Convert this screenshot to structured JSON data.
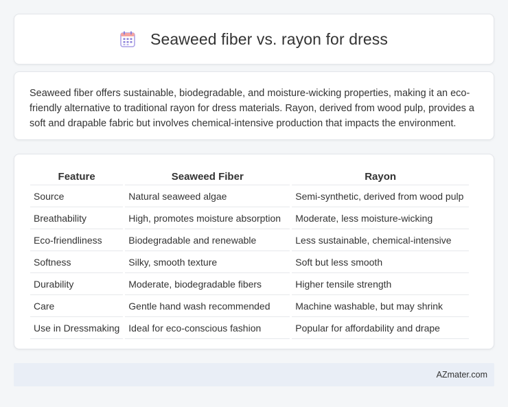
{
  "header": {
    "icon": "calendar-icon",
    "title": "Seaweed fiber vs. rayon for dress"
  },
  "summary": {
    "text": "Seaweed fiber offers sustainable, biodegradable, and moisture-wicking properties, making it an eco-friendly alternative to traditional rayon for dress materials. Rayon, derived from wood pulp, provides a soft and drapable fabric but involves chemical-intensive production that impacts the environment."
  },
  "table": {
    "headers": [
      "Feature",
      "Seaweed Fiber",
      "Rayon"
    ],
    "rows": [
      [
        "Source",
        "Natural seaweed algae",
        "Semi-synthetic, derived from wood pulp"
      ],
      [
        "Breathability",
        "High, promotes moisture absorption",
        "Moderate, less moisture-wicking"
      ],
      [
        "Eco-friendliness",
        "Biodegradable and renewable",
        "Less sustainable, chemical-intensive"
      ],
      [
        "Softness",
        "Silky, smooth texture",
        "Soft but less smooth"
      ],
      [
        "Durability",
        "Moderate, biodegradable fibers",
        "Higher tensile strength"
      ],
      [
        "Care",
        "Gentle hand wash recommended",
        "Machine washable, but may shrink"
      ],
      [
        "Use in Dressmaking",
        "Ideal for eco-conscious fashion",
        "Popular for affordability and drape"
      ]
    ]
  },
  "footer": {
    "brand": "AZmater.com"
  },
  "colors": {
    "icon_purple": "#8b7fd8",
    "icon_top": "#f28b82",
    "footer_bg": "#e9eef6"
  }
}
